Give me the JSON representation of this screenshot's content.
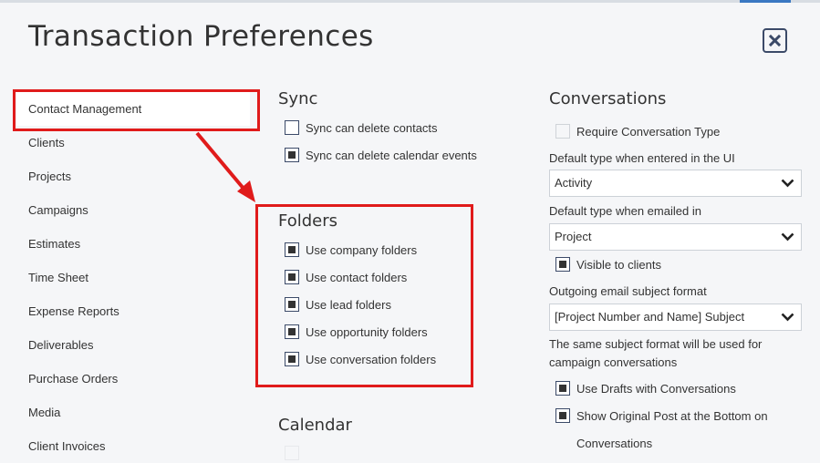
{
  "dialog": {
    "title": "Transaction Preferences"
  },
  "sidebar": {
    "items": [
      {
        "label": "Contact Management"
      },
      {
        "label": "Clients"
      },
      {
        "label": "Projects"
      },
      {
        "label": "Campaigns"
      },
      {
        "label": "Estimates"
      },
      {
        "label": "Time Sheet"
      },
      {
        "label": "Expense Reports"
      },
      {
        "label": "Deliverables"
      },
      {
        "label": "Purchase Orders"
      },
      {
        "label": "Media"
      },
      {
        "label": "Client Invoices"
      }
    ],
    "active_index": 0
  },
  "sync": {
    "title": "Sync",
    "options": [
      {
        "label": "Sync can delete contacts",
        "checked": false
      },
      {
        "label": "Sync can delete calendar events",
        "checked": true
      }
    ]
  },
  "folders": {
    "title": "Folders",
    "options": [
      {
        "label": "Use company folders",
        "checked": true
      },
      {
        "label": "Use contact folders",
        "checked": true
      },
      {
        "label": "Use lead folders",
        "checked": true
      },
      {
        "label": "Use opportunity folders",
        "checked": true
      },
      {
        "label": "Use conversation folders",
        "checked": true
      }
    ]
  },
  "calendar": {
    "title": "Calendar"
  },
  "conversations": {
    "title": "Conversations",
    "require_type": {
      "label": "Require Conversation Type",
      "checked": false,
      "disabled": true
    },
    "default_ui": {
      "label": "Default type when entered in the UI",
      "value": "Activity"
    },
    "default_email": {
      "label": "Default type when emailed in",
      "value": "Project"
    },
    "visible_to_clients": {
      "label": "Visible to clients",
      "checked": true
    },
    "subject_format": {
      "label": "Outgoing email subject format",
      "value": "[Project Number and Name] Subject"
    },
    "subject_note": "The same subject format will be used for campaign conversations",
    "use_drafts": {
      "label": "Use Drafts with Conversations",
      "checked": true
    },
    "show_original": {
      "label": "Show Original Post at the Bottom on",
      "label2": "Conversations",
      "checked": true
    }
  }
}
